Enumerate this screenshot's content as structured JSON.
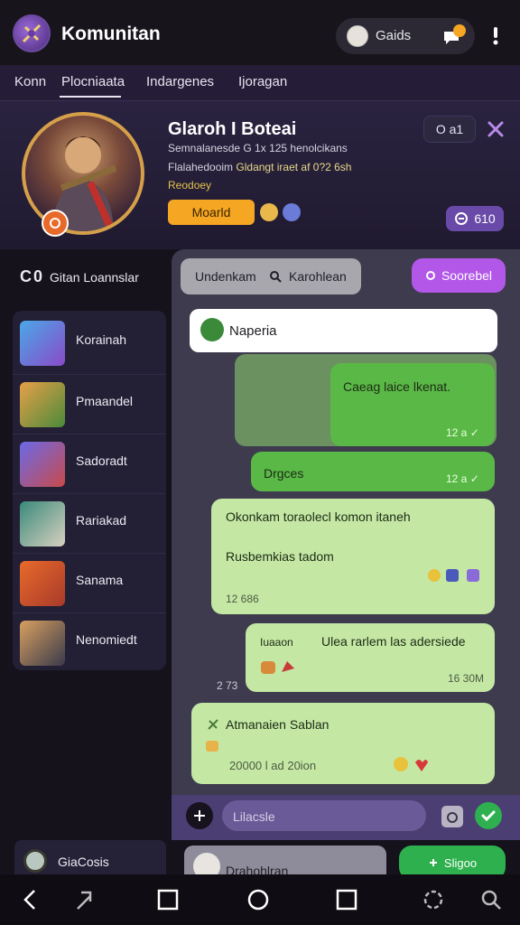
{
  "app": {
    "title": "Komunitan",
    "user_name": "Gaids"
  },
  "tabs": [
    {
      "label": "Konn"
    },
    {
      "label": "Plocniaata"
    },
    {
      "label": "Indargenes"
    },
    {
      "label": "Ijoragan"
    }
  ],
  "profile": {
    "name": "Glaroh I Boteai",
    "line1": "Semnalanesde G 1x 125 henolcikans",
    "line2_muted": "Flalahedooim",
    "line2_gold": "Gldangt iraet af 0?2 6sh",
    "line3": "Reodoey",
    "chip_label": "Moarld",
    "count": "O a1",
    "stat": "610"
  },
  "sidebar": {
    "title_code": "C0",
    "title": "Gitan Loannslar",
    "items": [
      {
        "label": "Korainah"
      },
      {
        "label": "Pmaandel"
      },
      {
        "label": "Sadoradt"
      },
      {
        "label": "Rariakad"
      },
      {
        "label": "Sanama"
      },
      {
        "label": "Nenomiedt"
      }
    ],
    "footer_label": "GiaCosis"
  },
  "chat": {
    "filter_left": "Undenkam",
    "filter_right": "Karohlean",
    "filter_button": "Soorebel",
    "pinned": "Naperia",
    "messages": [
      {
        "text": "Caeag laice lkenat.",
        "time": "12 a ✓"
      },
      {
        "text": "Drgces",
        "time": "12 a ✓"
      },
      {
        "text": "Okonkam toraolecl komon itaneh",
        "text2": "Rusbemkias tadom",
        "time": "12 686"
      },
      {
        "text": "Iuaaon",
        "text_right": "Ulea rarlem las adersiede",
        "time": "16 30M"
      },
      {
        "text": "Atmanaien Sablan",
        "meta": "20000 l ad 20ion"
      }
    ],
    "side_time": "2 73",
    "input_placeholder": "Lilacsle",
    "reply_label": "Drahohlran",
    "action_button": "Sligoo"
  },
  "colors": {
    "accent": "#b257e8",
    "bubble_green": "#5ab846",
    "bubble_light": "#c4e8a4",
    "chip_orange": "#f5a623",
    "send_green": "#2fb050"
  },
  "icons": [
    "app-logo-icon",
    "user-avatar-icon",
    "notification-icon",
    "more-icon",
    "close-icon",
    "coin-icon",
    "shield-icon",
    "stats-icon",
    "search-icon",
    "filter-icon",
    "pin-icon",
    "emoji-icon",
    "attach-icon",
    "camera-icon",
    "send-icon",
    "back-icon",
    "share-icon",
    "square-icon",
    "home-icon",
    "recent-icon",
    "settings-icon",
    "security-icon"
  ]
}
